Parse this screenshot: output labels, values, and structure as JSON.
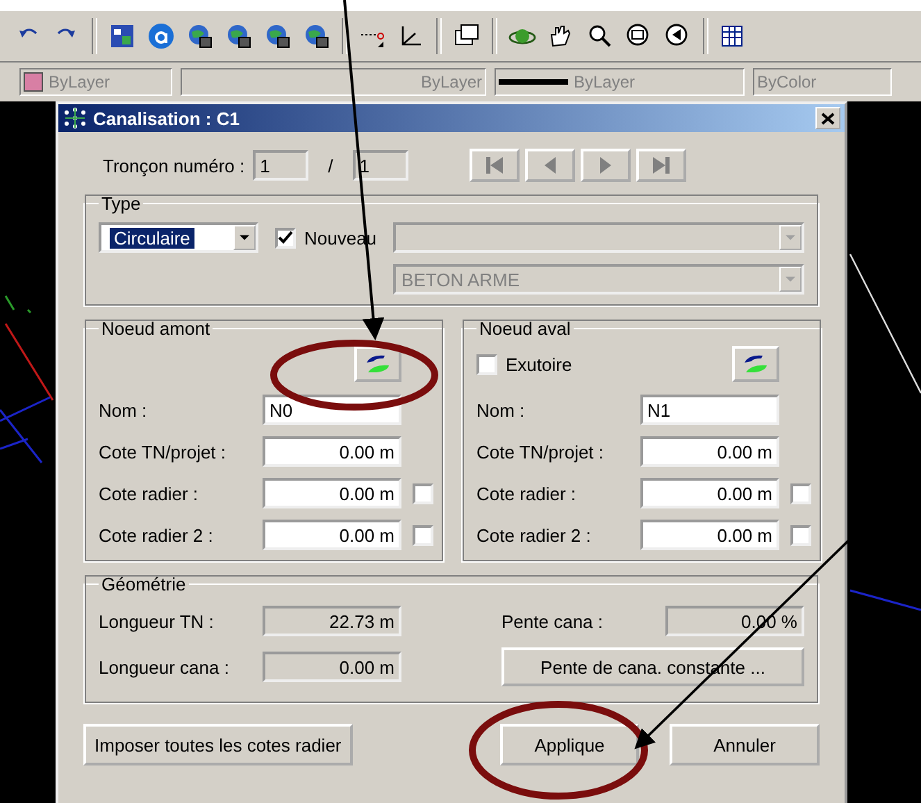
{
  "layer_bar": {
    "combos": [
      {
        "kind": "color",
        "value": "ByLayer"
      },
      {
        "kind": "plain",
        "value": "ByLayer"
      },
      {
        "kind": "linetype",
        "value": "ByLayer"
      },
      {
        "kind": "plain",
        "value": "ByColor"
      }
    ]
  },
  "dialog": {
    "title": "Canalisation : C1",
    "troncon": {
      "label": "Tronçon numéro :",
      "current": "1",
      "separator": "/",
      "total": "1",
      "nav": [
        {
          "kind": "first"
        },
        {
          "kind": "prev"
        },
        {
          "kind": "next"
        },
        {
          "kind": "last"
        }
      ]
    },
    "type": {
      "legend": "Type",
      "shape": "Circulaire",
      "nouveau": {
        "label": "Nouveau",
        "checked": true
      },
      "combo_1": {
        "disabled": true
      },
      "combo_2": {
        "value": "BETON ARME",
        "disabled": true
      }
    },
    "nodes": [
      {
        "legend": "Noeud amont",
        "fields": [
          {
            "kind": "name",
            "label": "Nom :",
            "value": "N0"
          },
          {
            "kind": "measure",
            "label": "Cote TN/projet :",
            "value": "0.00 m"
          },
          {
            "kind": "measure",
            "label": "Cote radier :",
            "value": "0.00 m",
            "checked": false
          },
          {
            "kind": "measure",
            "label": "Cote radier 2 :",
            "value": "0.00 m",
            "checked": false
          }
        ]
      },
      {
        "legend": "Noeud aval",
        "exutoire": {
          "label": "Exutoire",
          "checked": false
        },
        "fields": [
          {
            "kind": "name",
            "label": "Nom :",
            "value": "N1"
          },
          {
            "kind": "measure",
            "label": "Cote TN/projet :",
            "value": "0.00 m"
          },
          {
            "kind": "measure",
            "label": "Cote radier :",
            "value": "0.00 m",
            "checked": false
          },
          {
            "kind": "measure",
            "label": "Cote radier 2 :",
            "value": "0.00 m",
            "checked": false
          }
        ]
      }
    ],
    "geometrie": {
      "legend": "Géométrie",
      "longueur_tn": {
        "label": "Longueur TN :",
        "value": "22.73 m"
      },
      "longueur_cana": {
        "label": "Longueur cana :",
        "value": "0.00 m"
      },
      "pente_cana": {
        "label": "Pente cana :",
        "value": "0.00 %"
      },
      "pente_button": "Pente de cana. constante ..."
    },
    "buttons": {
      "imposer": "Imposer toutes les cotes radier",
      "appliquer": "Applique",
      "annuler": "Annuler"
    }
  }
}
